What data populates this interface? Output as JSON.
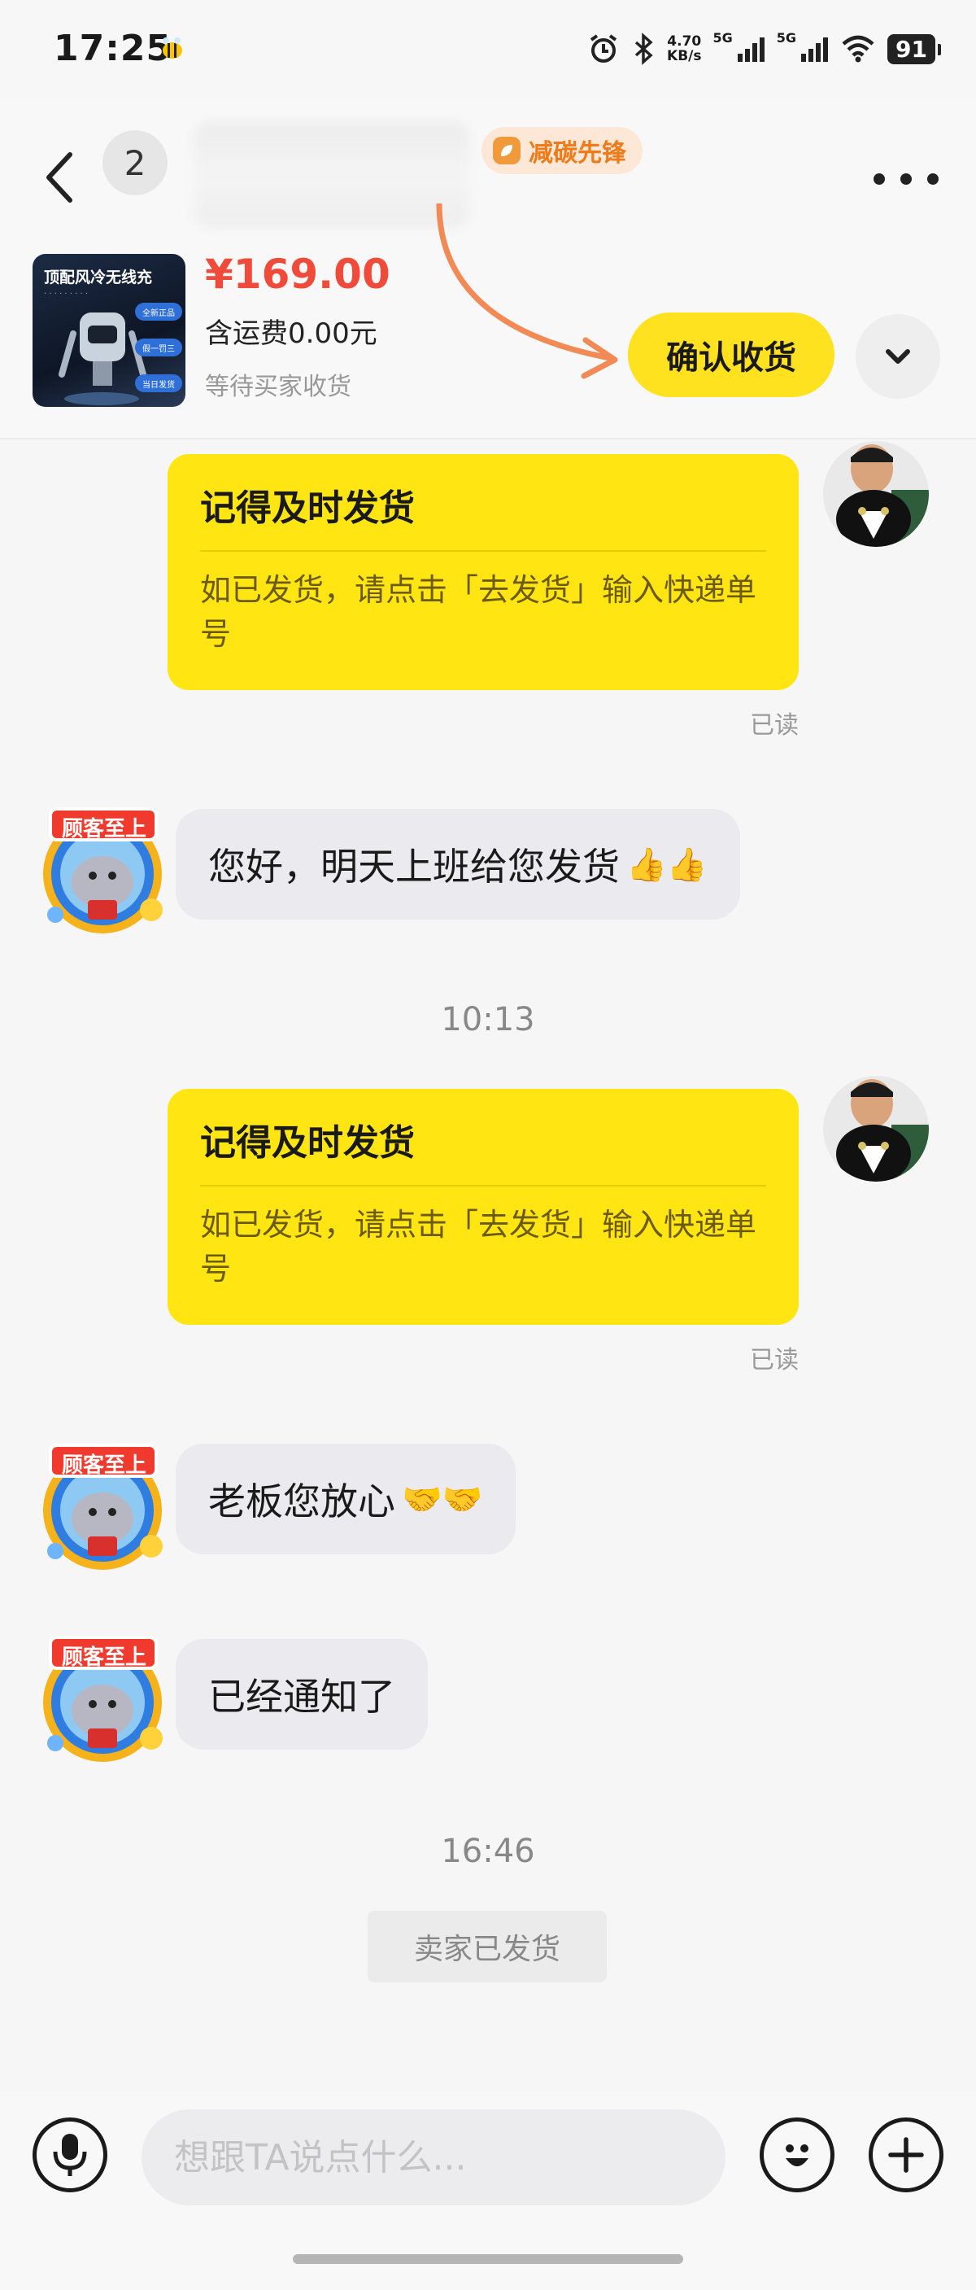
{
  "status_bar": {
    "time": "17:25",
    "net_speed_value": "4.70",
    "net_speed_unit": "KB/s",
    "signal_1": "5G",
    "signal_2": "5G",
    "battery": "91",
    "icons": [
      "bee-icon",
      "alarm-icon",
      "bluetooth-icon",
      "signal-icon",
      "wifi-icon",
      "battery-icon"
    ]
  },
  "header": {
    "unread_count": "2",
    "badge_label": "减碳先锋",
    "icons": [
      "back-chevron-icon",
      "more-dots-icon",
      "leaf-icon"
    ]
  },
  "product": {
    "thumb_title": "顶配风冷无线充",
    "thumb_tags": [
      "全新正品",
      "假一罚三",
      "当日发货"
    ],
    "price": "¥169.00",
    "shipping": "含运费0.00元",
    "status": "等待买家收货",
    "confirm_label": "确认收货"
  },
  "messages": {
    "card1": {
      "title": "记得及时发货",
      "body": "如已发货，请点击「去发货」输入快递单号",
      "read": "已读"
    },
    "seller_msg1": "您好，明天上班给您发货",
    "seller_msg1_emoji": "👍👍",
    "time1": "10:13",
    "card2": {
      "title": "记得及时发货",
      "body": "如已发货，请点击「去发货」输入快递单号",
      "read": "已读"
    },
    "seller_msg2": "老板您放心",
    "seller_msg2_emoji": "🤝🤝",
    "seller_msg3": "已经通知了",
    "time2": "16:46",
    "system_notice": "卖家已发货",
    "seller_avatar_text": "顾客至上"
  },
  "input_bar": {
    "placeholder": "想跟TA说点什么...",
    "icons": [
      "microphone-icon",
      "smiley-icon",
      "plus-icon"
    ]
  },
  "colors": {
    "accent_yellow": "#ffe512",
    "price_red": "#f04a3a",
    "badge_orange": "#f07a18"
  }
}
